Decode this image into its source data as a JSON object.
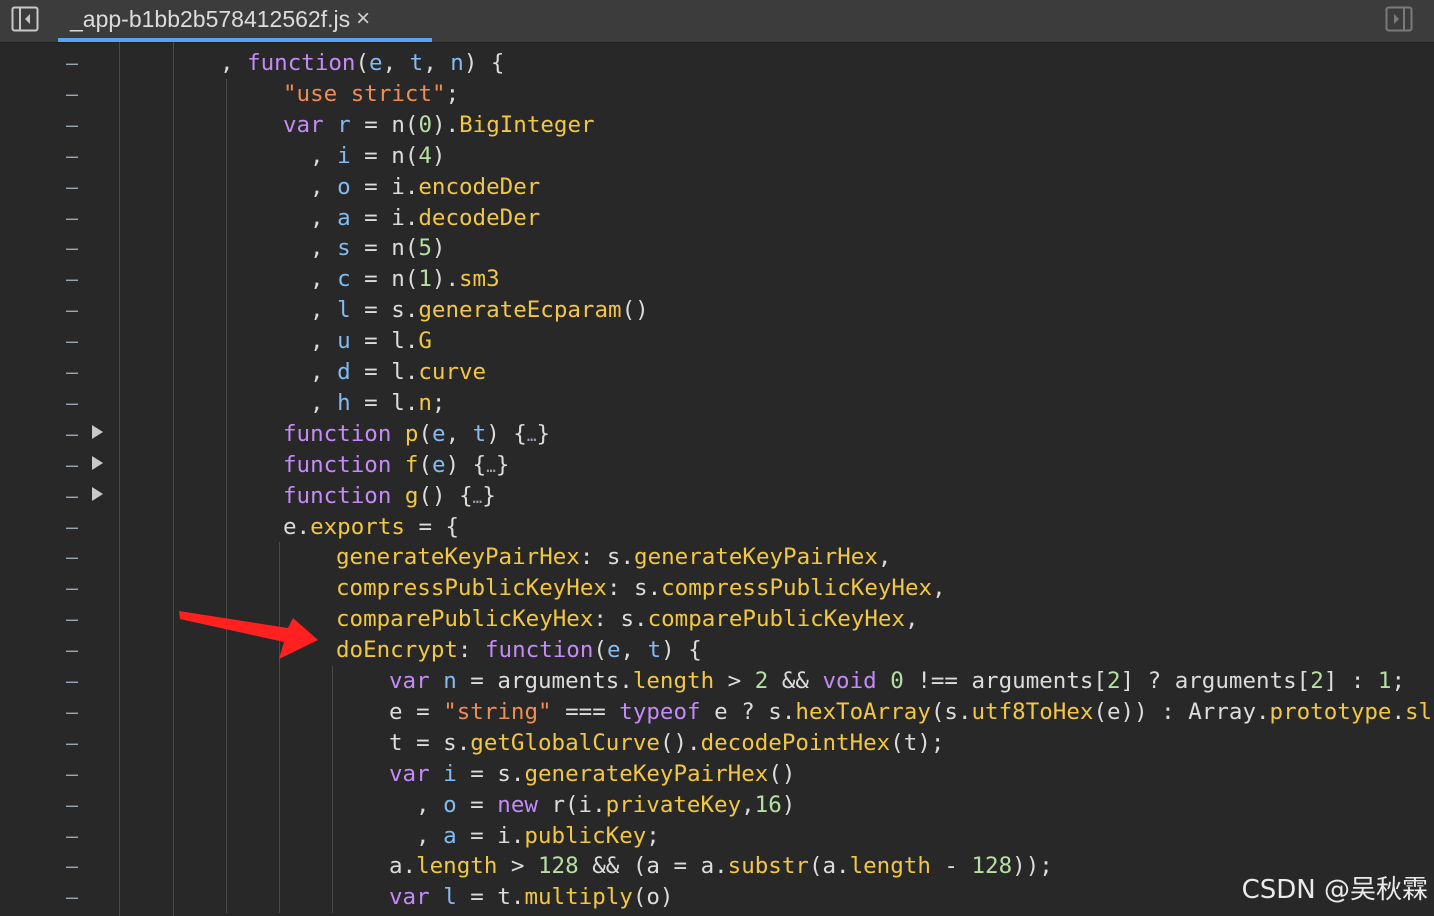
{
  "tab": {
    "filename": "_app-b1bb2b578412562f.js",
    "close": "×"
  },
  "icons": {
    "left": "toggle-navigator-icon",
    "right": "toggle-debugger-icon"
  },
  "gutter_marker": "–",
  "watermark": "CSDN @吴秋霖",
  "highlight_color": "#ff2020",
  "lines": [
    {
      "i": 220,
      "t": [
        [
          ", ",
          "plain"
        ],
        [
          "function",
          "kw"
        ],
        [
          "(",
          "plain"
        ],
        [
          "e",
          "var"
        ],
        [
          ", ",
          "plain"
        ],
        [
          "t",
          "var"
        ],
        [
          ", ",
          "plain"
        ],
        [
          "n",
          "var"
        ],
        [
          ") {",
          "plain"
        ]
      ]
    },
    {
      "i": 283,
      "t": [
        [
          "\"use strict\"",
          "str"
        ],
        [
          ";",
          "plain"
        ]
      ]
    },
    {
      "i": 283,
      "t": [
        [
          "var ",
          "kw"
        ],
        [
          "r",
          "var"
        ],
        [
          " = n(",
          "plain"
        ],
        [
          "0",
          "num"
        ],
        [
          ").",
          "plain"
        ],
        [
          "BigInteger",
          "prop"
        ]
      ]
    },
    {
      "i": 310,
      "t": [
        [
          ", ",
          "plain"
        ],
        [
          "i",
          "var"
        ],
        [
          " = n(",
          "plain"
        ],
        [
          "4",
          "num"
        ],
        [
          ")",
          "plain"
        ]
      ]
    },
    {
      "i": 310,
      "t": [
        [
          ", ",
          "plain"
        ],
        [
          "o",
          "var"
        ],
        [
          " = i.",
          "plain"
        ],
        [
          "encodeDer",
          "prop"
        ]
      ]
    },
    {
      "i": 310,
      "t": [
        [
          ", ",
          "plain"
        ],
        [
          "a",
          "var"
        ],
        [
          " = i.",
          "plain"
        ],
        [
          "decodeDer",
          "prop"
        ]
      ]
    },
    {
      "i": 310,
      "t": [
        [
          ", ",
          "plain"
        ],
        [
          "s",
          "var"
        ],
        [
          " = n(",
          "plain"
        ],
        [
          "5",
          "num"
        ],
        [
          ")",
          "plain"
        ]
      ]
    },
    {
      "i": 310,
      "t": [
        [
          ", ",
          "plain"
        ],
        [
          "c",
          "var"
        ],
        [
          " = n(",
          "plain"
        ],
        [
          "1",
          "num"
        ],
        [
          ").",
          "plain"
        ],
        [
          "sm3",
          "prop"
        ]
      ]
    },
    {
      "i": 310,
      "t": [
        [
          ", ",
          "plain"
        ],
        [
          "l",
          "var"
        ],
        [
          " = s.",
          "plain"
        ],
        [
          "generateEcparam",
          "prop"
        ],
        [
          "()",
          "plain"
        ]
      ]
    },
    {
      "i": 310,
      "t": [
        [
          ", ",
          "plain"
        ],
        [
          "u",
          "var"
        ],
        [
          " = l.",
          "plain"
        ],
        [
          "G",
          "prop"
        ]
      ]
    },
    {
      "i": 310,
      "t": [
        [
          ", ",
          "plain"
        ],
        [
          "d",
          "var"
        ],
        [
          " = l.",
          "plain"
        ],
        [
          "curve",
          "prop"
        ]
      ]
    },
    {
      "i": 310,
      "t": [
        [
          ", ",
          "plain"
        ],
        [
          "h",
          "var"
        ],
        [
          " = l.",
          "plain"
        ],
        [
          "n",
          "prop"
        ],
        [
          ";",
          "plain"
        ]
      ]
    },
    {
      "i": 283,
      "x": true,
      "t": [
        [
          "function ",
          "kw"
        ],
        [
          "p",
          "prop"
        ],
        [
          "(",
          "plain"
        ],
        [
          "e",
          "var"
        ],
        [
          ", ",
          "plain"
        ],
        [
          "t",
          "var"
        ],
        [
          ") {",
          "plain"
        ],
        [
          "…",
          "ell"
        ],
        [
          "}",
          "plain"
        ]
      ]
    },
    {
      "i": 283,
      "x": true,
      "t": [
        [
          "function ",
          "kw"
        ],
        [
          "f",
          "prop"
        ],
        [
          "(",
          "plain"
        ],
        [
          "e",
          "var"
        ],
        [
          ") {",
          "plain"
        ],
        [
          "…",
          "ell"
        ],
        [
          "}",
          "plain"
        ]
      ]
    },
    {
      "i": 283,
      "x": true,
      "t": [
        [
          "function ",
          "kw"
        ],
        [
          "g",
          "prop"
        ],
        [
          "() {",
          "plain"
        ],
        [
          "…",
          "ell"
        ],
        [
          "}",
          "plain"
        ]
      ]
    },
    {
      "i": 283,
      "t": [
        [
          "e.",
          "plain"
        ],
        [
          "exports",
          "prop"
        ],
        [
          " = {",
          "plain"
        ]
      ]
    },
    {
      "i": 336,
      "t": [
        [
          "generateKeyPairHex",
          "prop"
        ],
        [
          ": s.",
          "plain"
        ],
        [
          "generateKeyPairHex",
          "prop"
        ],
        [
          ",",
          "plain"
        ]
      ]
    },
    {
      "i": 336,
      "t": [
        [
          "compressPublicKeyHex",
          "prop"
        ],
        [
          ": s.",
          "plain"
        ],
        [
          "compressPublicKeyHex",
          "prop"
        ],
        [
          ",",
          "plain"
        ]
      ]
    },
    {
      "i": 336,
      "t": [
        [
          "comparePublicKeyHex",
          "prop"
        ],
        [
          ": s.",
          "plain"
        ],
        [
          "comparePublicKeyHex",
          "prop"
        ],
        [
          ",",
          "plain"
        ]
      ]
    },
    {
      "i": 336,
      "t": [
        [
          "doEncrypt",
          "prop"
        ],
        [
          ": ",
          "plain"
        ],
        [
          "function",
          "kw"
        ],
        [
          "(",
          "plain"
        ],
        [
          "e",
          "var"
        ],
        [
          ", ",
          "plain"
        ],
        [
          "t",
          "var"
        ],
        [
          ") {",
          "plain"
        ]
      ]
    },
    {
      "i": 389,
      "t": [
        [
          "var ",
          "kw"
        ],
        [
          "n",
          "var"
        ],
        [
          " = arguments.",
          "plain"
        ],
        [
          "length",
          "prop"
        ],
        [
          " > ",
          "plain"
        ],
        [
          "2",
          "num"
        ],
        [
          " && ",
          "plain"
        ],
        [
          "void ",
          "kw"
        ],
        [
          "0",
          "num"
        ],
        [
          " !== arguments[",
          "plain"
        ],
        [
          "2",
          "num"
        ],
        [
          "] ? arguments[",
          "plain"
        ],
        [
          "2",
          "num"
        ],
        [
          "] : ",
          "plain"
        ],
        [
          "1",
          "num"
        ],
        [
          ";",
          "plain"
        ]
      ]
    },
    {
      "i": 389,
      "t": [
        [
          "e = ",
          "plain"
        ],
        [
          "\"string\"",
          "str"
        ],
        [
          " === ",
          "plain"
        ],
        [
          "typeof ",
          "kw"
        ],
        [
          "e ? s.",
          "plain"
        ],
        [
          "hexToArray",
          "prop"
        ],
        [
          "(s.",
          "plain"
        ],
        [
          "utf8ToHex",
          "prop"
        ],
        [
          "(e)) : Array.",
          "plain"
        ],
        [
          "prototype",
          "prop"
        ],
        [
          ".",
          "plain"
        ],
        [
          "slice",
          "prop"
        ]
      ]
    },
    {
      "i": 389,
      "t": [
        [
          "t = s.",
          "plain"
        ],
        [
          "getGlobalCurve",
          "prop"
        ],
        [
          "().",
          "plain"
        ],
        [
          "decodePointHex",
          "prop"
        ],
        [
          "(t);",
          "plain"
        ]
      ]
    },
    {
      "i": 389,
      "t": [
        [
          "var ",
          "kw"
        ],
        [
          "i",
          "var"
        ],
        [
          " = s.",
          "plain"
        ],
        [
          "generateKeyPairHex",
          "prop"
        ],
        [
          "()",
          "plain"
        ]
      ]
    },
    {
      "i": 416,
      "t": [
        [
          ", ",
          "plain"
        ],
        [
          "o",
          "var"
        ],
        [
          " = ",
          "plain"
        ],
        [
          "new ",
          "kw"
        ],
        [
          "r(i.",
          "plain"
        ],
        [
          "privateKey",
          "prop"
        ],
        [
          ",",
          "plain"
        ],
        [
          "16",
          "num"
        ],
        [
          ")",
          "plain"
        ]
      ]
    },
    {
      "i": 416,
      "t": [
        [
          ", ",
          "plain"
        ],
        [
          "a",
          "var"
        ],
        [
          " = i.",
          "plain"
        ],
        [
          "publicKey",
          "prop"
        ],
        [
          ";",
          "plain"
        ]
      ]
    },
    {
      "i": 389,
      "t": [
        [
          "a.",
          "plain"
        ],
        [
          "length",
          "prop"
        ],
        [
          " > ",
          "plain"
        ],
        [
          "128",
          "num"
        ],
        [
          " && (a = a.",
          "plain"
        ],
        [
          "substr",
          "prop"
        ],
        [
          "(a.",
          "plain"
        ],
        [
          "length",
          "prop"
        ],
        [
          " - ",
          "plain"
        ],
        [
          "128",
          "num"
        ],
        [
          "));",
          "plain"
        ]
      ]
    },
    {
      "i": 389,
      "t": [
        [
          "var ",
          "kw"
        ],
        [
          "l",
          "var"
        ],
        [
          " = t.",
          "plain"
        ],
        [
          "multiply",
          "prop"
        ],
        [
          "(o)",
          "plain"
        ]
      ]
    }
  ]
}
